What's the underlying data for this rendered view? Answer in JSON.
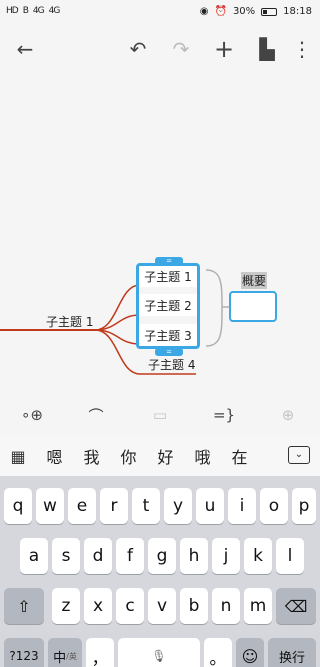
{
  "status_bar": {
    "left_icons": [
      "HD",
      "B",
      "4G",
      "4G"
    ],
    "battery": "30%",
    "time": "18:18"
  },
  "toolbar": {
    "back_icon": "←",
    "undo_icon": "↶",
    "redo_icon": "↷",
    "add_icon": "+",
    "format_icon": "▙",
    "more_icon": "⋮"
  },
  "mindmap": {
    "parent": "子主题 1",
    "children": [
      "子主题 1",
      "子主题 2",
      "子主题 3",
      "子主题 4"
    ],
    "summary_label": "概要",
    "handle_glyph": "="
  },
  "bottom_tools": {
    "add_node_icon": "∘⊕",
    "relationship_icon": "⌒",
    "note_icon": "▭",
    "summary_icon": "=}",
    "insert_icon": "⊕"
  },
  "keyboard": {
    "grid_icon": "▦",
    "candidates": [
      "嗯",
      "我",
      "你",
      "好",
      "哦",
      "在"
    ],
    "hide_icon": "⌄",
    "row1": [
      "q",
      "w",
      "e",
      "r",
      "t",
      "y",
      "u",
      "i",
      "o",
      "p"
    ],
    "row2": [
      "a",
      "s",
      "d",
      "f",
      "g",
      "h",
      "j",
      "k",
      "l"
    ],
    "row3": [
      "z",
      "x",
      "c",
      "v",
      "b",
      "n",
      "m"
    ],
    "shift_icon": "⇧",
    "delete_icon": "⌫",
    "num_key": "?123",
    "lang_key": "中",
    "lang_sub": "/英",
    "comma": "，",
    "period": "。",
    "emoji_icon": "☺",
    "enter_key": "换行",
    "mic_icon": "🎙"
  },
  "colors": {
    "accent_blue": "#3ba7e5",
    "branch_red": "#c0391b",
    "summary_gray": "#c9c9c9"
  }
}
